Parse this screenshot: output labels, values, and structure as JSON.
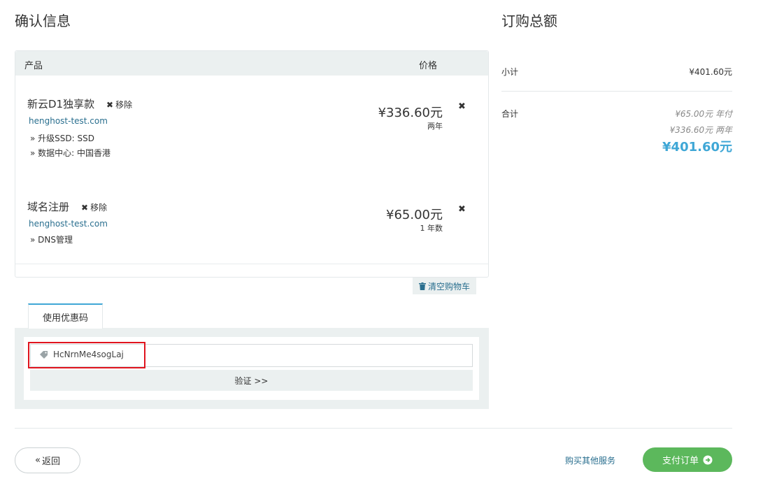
{
  "page": {
    "title": "确认信息",
    "summary_title": "订购总额"
  },
  "cart": {
    "header_product": "产品",
    "header_price": "价格",
    "items": [
      {
        "name": "新云D1独享款",
        "remove_label": "移除",
        "domain": "henghost-test.com",
        "details": [
          "» 升级SSD: SSD",
          "» 数据中心: 中国香港"
        ],
        "price": "¥336.60元",
        "cycle": "两年"
      },
      {
        "name": "域名注册",
        "remove_label": "移除",
        "domain": "henghost-test.com",
        "details": [
          "» DNS管理"
        ],
        "price": "¥65.00元",
        "cycle": "1 年数"
      }
    ],
    "clear_label": "清空购物车"
  },
  "promo": {
    "tab_label": "使用优惠码",
    "code_value": "HcNrnMe4sogLaj",
    "verify_label": "验证 >>"
  },
  "summary": {
    "subtotal_label": "小计",
    "subtotal_value": "¥401.60元",
    "total_label": "合计",
    "line1": "¥65.00元 年付",
    "line2": "¥336.60元 两年",
    "total_value": "¥401.60元"
  },
  "footer": {
    "back_label": "返回",
    "more_services": "购买其他服务",
    "pay_label": "支付订单"
  },
  "colors": {
    "accent": "#3fa7d6",
    "pay_green": "#5cb85c",
    "link": "#2a6f8f",
    "highlight_red": "#e0141e"
  }
}
